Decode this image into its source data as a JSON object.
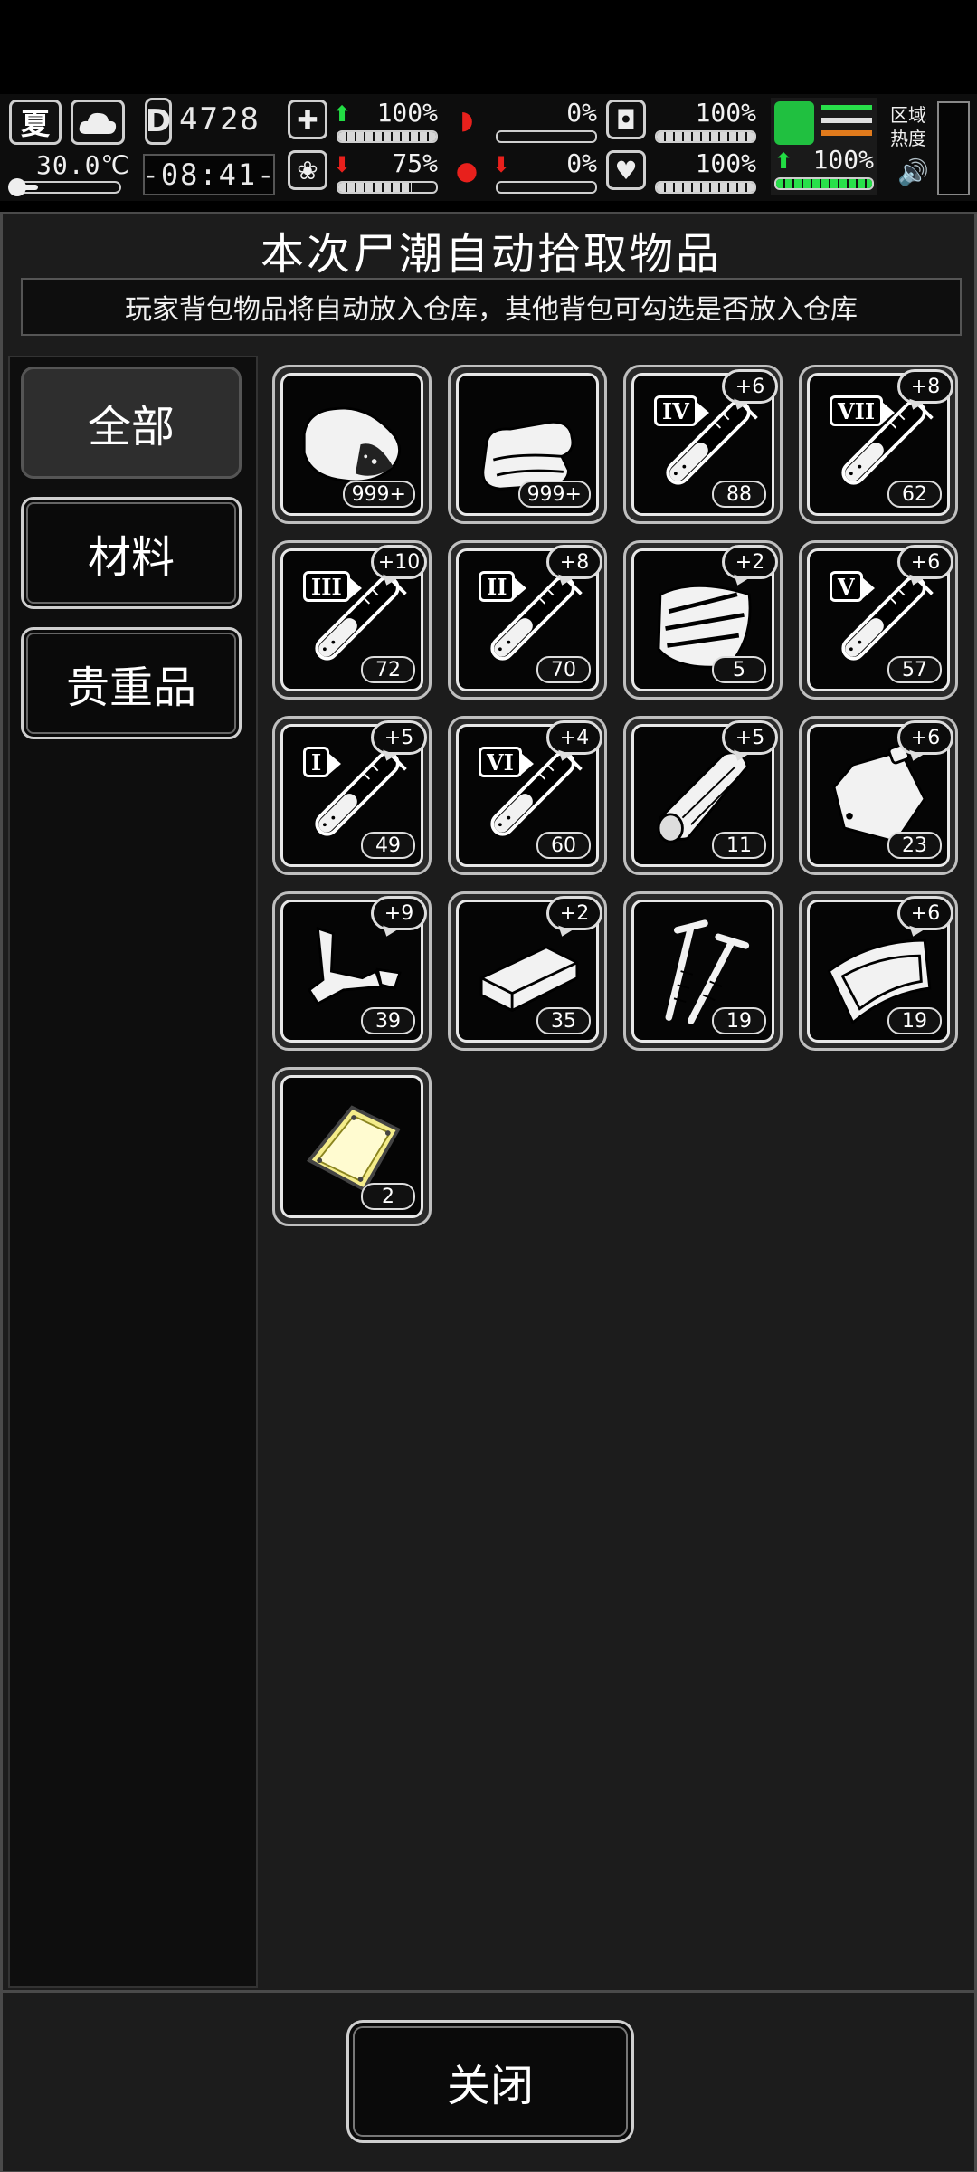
{
  "hud": {
    "season": "夏",
    "temperature": "30.0℃",
    "day_label": "D",
    "day_number": "4728",
    "clock": "-08:41-",
    "stats": [
      {
        "name": "health",
        "value": "100%",
        "arrow": "up",
        "level": 1.0
      },
      {
        "name": "hunger",
        "value": "0%",
        "arrow": "none",
        "level": 0.0
      },
      {
        "name": "water",
        "value": "100%",
        "arrow": "none",
        "level": 1.0
      },
      {
        "name": "sanity",
        "value": "75%",
        "arrow": "down",
        "level": 0.75
      },
      {
        "name": "blood",
        "value": "0%",
        "arrow": "down",
        "level": 0.0
      },
      {
        "name": "mood",
        "value": "100%",
        "arrow": "none",
        "level": 1.0
      }
    ],
    "stamina": {
      "value": "100%",
      "arrow": "up",
      "level": 1.0
    },
    "region_label": "区域热度",
    "colors": {
      "up": "#22dd44",
      "down": "#e8201c",
      "stamina": "#28e04a"
    }
  },
  "panel": {
    "title": "本次尸潮自动拾取物品",
    "notice": "玩家背包物品将自动放入仓库，其他背包可勾选是否放入仓库"
  },
  "tabs": [
    {
      "label": "全部",
      "active": true
    },
    {
      "label": "材料",
      "active": false
    },
    {
      "label": "贵重品",
      "active": false
    }
  ],
  "items": [
    {
      "icon": "meat-icon",
      "count": "999+",
      "bonus": "",
      "tier": ""
    },
    {
      "icon": "cloth-icon",
      "count": "999+",
      "bonus": "",
      "tier": ""
    },
    {
      "icon": "test-tube-icon",
      "count": "88",
      "bonus": "+6",
      "tier": "IV"
    },
    {
      "icon": "test-tube-icon",
      "count": "62",
      "bonus": "+8",
      "tier": "VII"
    },
    {
      "icon": "test-tube-icon",
      "count": "72",
      "bonus": "+10",
      "tier": "III"
    },
    {
      "icon": "test-tube-icon",
      "count": "70",
      "bonus": "+8",
      "tier": "II"
    },
    {
      "icon": "wood-planks-icon",
      "count": "5",
      "bonus": "+2",
      "tier": ""
    },
    {
      "icon": "test-tube-icon",
      "count": "57",
      "bonus": "+6",
      "tier": "V"
    },
    {
      "icon": "test-tube-icon",
      "count": "49",
      "bonus": "+5",
      "tier": "I"
    },
    {
      "icon": "test-tube-icon",
      "count": "60",
      "bonus": "+4",
      "tier": "VI"
    },
    {
      "icon": "log-icon",
      "count": "11",
      "bonus": "+5",
      "tier": ""
    },
    {
      "icon": "bag-icon",
      "count": "23",
      "bonus": "+6",
      "tier": ""
    },
    {
      "icon": "scrap-metal-icon",
      "count": "39",
      "bonus": "+9",
      "tier": ""
    },
    {
      "icon": "brick-icon",
      "count": "35",
      "bonus": "+2",
      "tier": ""
    },
    {
      "icon": "screws-icon",
      "count": "19",
      "bonus": "",
      "tier": ""
    },
    {
      "icon": "leather-icon",
      "count": "19",
      "bonus": "+6",
      "tier": ""
    },
    {
      "icon": "gold-plate-icon",
      "count": "2",
      "bonus": "",
      "tier": ""
    }
  ],
  "footer": {
    "close_label": "关闭"
  }
}
